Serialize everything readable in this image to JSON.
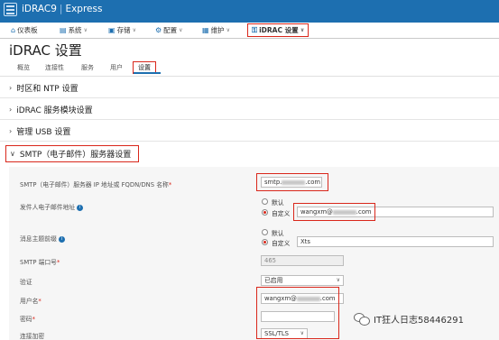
{
  "app": {
    "title": "iDRAC9",
    "edition": "Express"
  },
  "nav": {
    "items": [
      {
        "label": "仪表板",
        "icon": "home-icon"
      },
      {
        "label": "系统",
        "icon": "server-icon"
      },
      {
        "label": "存储",
        "icon": "storage-icon"
      },
      {
        "label": "配置",
        "icon": "config-icon"
      },
      {
        "label": "维护",
        "icon": "maintenance-icon"
      },
      {
        "label": "iDRAC 设置",
        "icon": "key-icon"
      }
    ]
  },
  "page": {
    "title": "iDRAC 设置"
  },
  "tabs": [
    "概览",
    "连接性",
    "服务",
    "用户",
    "设置"
  ],
  "sections": {
    "time_ntp": "时区和 NTP 设置",
    "service_module": "iDRAC 服务模块设置",
    "usb": "管理 USB 设置",
    "smtp": "SMTP（电子邮件）服务器设置"
  },
  "smtp_form": {
    "server_label": "SMTP（电子邮件）服务器 IP 地址或 FQDN/DNS 名称",
    "server_prefix": "smtp.",
    "server_suffix": ".com",
    "sender_label": "发件人电子邮件地址",
    "sender_default": "默认",
    "sender_custom": "自定义",
    "sender_prefix": "wangxm@",
    "sender_suffix": ".com",
    "subject_label": "消息主题前缀",
    "subject_default": "默认",
    "subject_custom": "自定义",
    "subject_value": "Xts",
    "port_label": "SMTP 端口号",
    "port_value": "465",
    "auth_label": "验证",
    "auth_value": "已启用",
    "username_label": "用户名",
    "username_prefix": "wangxm@",
    "username_suffix": ".com",
    "password_label": "密码",
    "password_value": "",
    "encryption_label": "连接加密",
    "encryption_value": "SSL/TLS",
    "required_mark": "*"
  },
  "watermark": {
    "text": "IT狂人日志58446291",
    "icon": "wechat-icon"
  },
  "colors": {
    "accent": "#1d6fb0",
    "highlight": "#d9271b"
  }
}
